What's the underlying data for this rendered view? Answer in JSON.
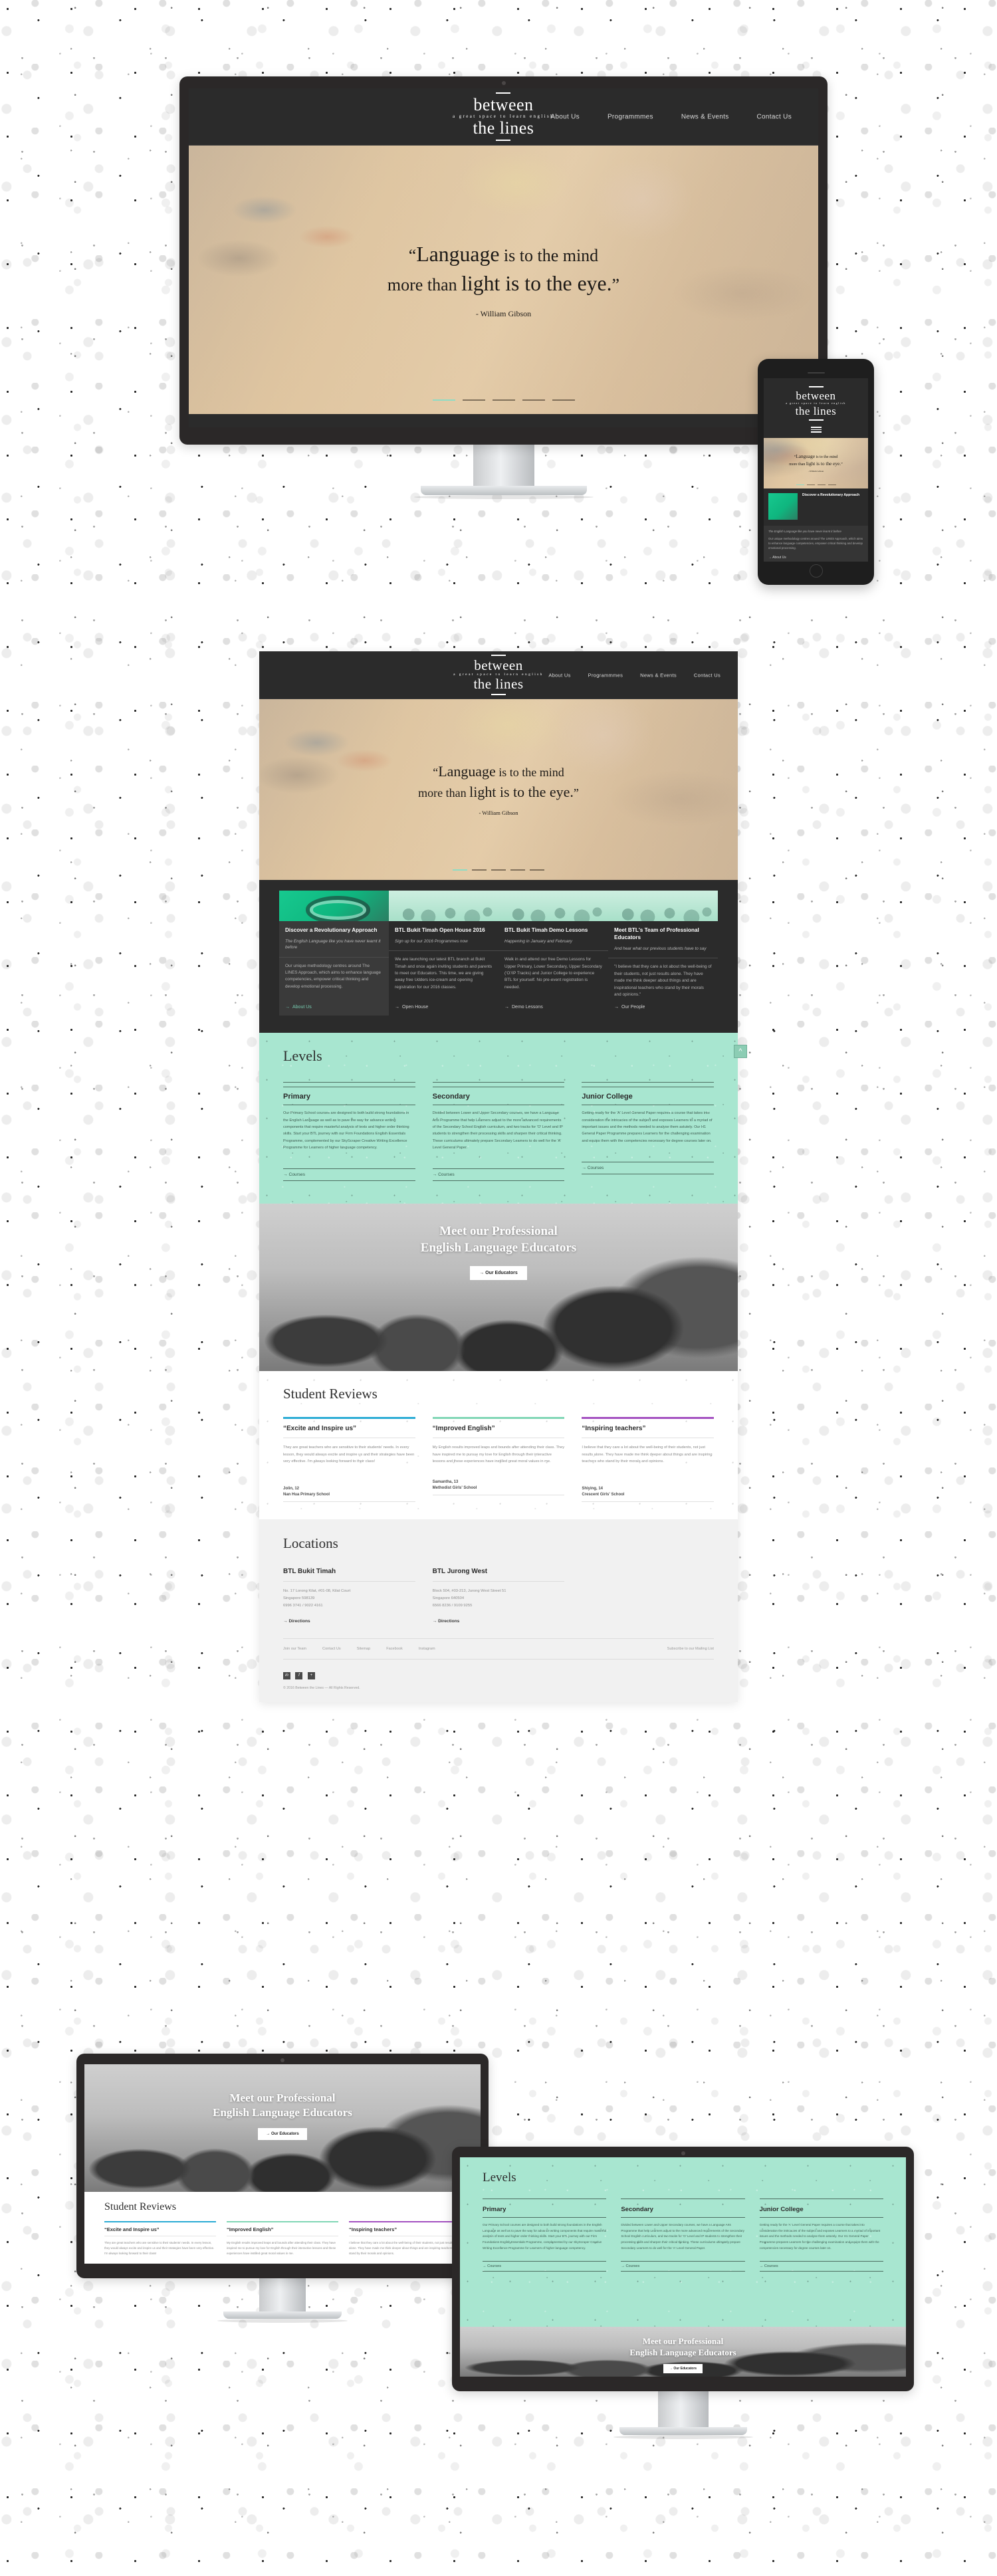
{
  "brand": {
    "line1": "between",
    "tagline": "a great space to learn english",
    "line2": "the lines"
  },
  "nav": [
    {
      "label": "About Us"
    },
    {
      "label": "Programmmes"
    },
    {
      "label": "News & Events"
    },
    {
      "label": "Contact Us"
    }
  ],
  "hero": {
    "quote_line1_emph": "Language",
    "quote_line1_rest": "is to the mind",
    "quote_line2_rest": "more than",
    "quote_line2_emph": "light is to the eye.",
    "attribution": "- William Gibson",
    "open_quote": "“",
    "close_quote": "”",
    "slider_count": 5,
    "slider_active": 1
  },
  "cards": [
    {
      "title": "Discover a Revolutionary Approach",
      "subtitle": "The English Language like you have never learnt it before",
      "body": "Our unique methodology centres around The LINES Approach, which aims to enhance language competencies, empower critical thinking and develop emotional processing.",
      "link": "About Us",
      "thumb": "lines-diagram-image",
      "active": true
    },
    {
      "title": "BTL Bukit Timah Open House 2016",
      "subtitle": "Sign up for our 2016 Programmes now",
      "body": "We are launching our latest BTL branch at Bukit Timah and once again inviting students and parents to meet our Educators. This time, we are giving away free Udders ice-cream and opening registration for our 2016 classes.",
      "link": "Open House",
      "thumb": "audience-photo",
      "active": false
    },
    {
      "title": "BTL Bukit Timah Demo Lessons",
      "subtitle": "Happening in January and February",
      "body": "Walk in and attend our free Demo Lessons for Upper Primary, Lower Secondary, Upper Secondary ('O'/IP Tracks) and Junior College to experience BTL for yourself. No pre-event registration is needed.",
      "link": "Demo Lessons",
      "thumb": "classroom-photo",
      "active": false
    },
    {
      "title": "Meet BTL's Team of Professional Educators",
      "subtitle": "And hear what our previous students have to say",
      "body": "\"I believe that they care a lot about the well-being of their students, not just results alone. They have made me think deeper about things and are inspirational teachers who stand by their morals and opinions.\"",
      "link": "Our People",
      "thumb": "educators-photo",
      "active": false
    }
  ],
  "levels": {
    "heading": "Levels",
    "items": [
      {
        "title": "Primary",
        "body": "Our Primary School courses are designed to both build strong foundations in the English Language as well as to pave the way for advance writing components that require masterful analysis of texts and higher order thinking skills. Start your BTL journey with our Firm Foundations English Essentials Programme, complemented by our SkyScraper Creative Writing Excellence Programme for Learners of higher language competency.",
        "link": "Courses"
      },
      {
        "title": "Secondary",
        "body": "Divided between Lower and Upper Secondary courses, we have a Language Arts Programme that help Learners adjust to the more advanced requirements of the Secondary School English curriculum, and two tracks for 'O' Level and IP students to strengthen their processing skills and sharpen their critical thinking. These curriculums ultimately prepare Secondary Learners to do well for the 'A' Level General Paper.",
        "link": "Courses"
      },
      {
        "title": "Junior College",
        "body": "Getting ready for the 'A' Level General Paper requires a course that takes into consideration the intricacies of the subject and exposes Learners to a myriad of important issues and the methods needed to analyse them astutely. Our H1 General Paper Programme prepares Learners for the challenging examination and equips them with the competencies necessary for degree courses later on.",
        "link": "Courses"
      }
    ],
    "scroll_top_icon": "chevron-up-icon"
  },
  "educators": {
    "heading_line1": "Meet our Professional",
    "heading_line2": "English Language Educators",
    "button": "Our Educators"
  },
  "reviews": {
    "heading": "Student Reviews",
    "items": [
      {
        "bar_color": "#29ABD4",
        "title": "“Excite and Inspire us”",
        "body": "They are great teachers who are sensitive to their students' needs. In every lesson, they would always excite and inspire us and their strategies have been very effective. I'm always looking forward to their class!",
        "name": "Jolin, 12",
        "school": "Nan Hua Primary School"
      },
      {
        "bar_color": "#7FD6B5",
        "title": "“Improved English”",
        "body": "My English results improved leaps and bounds after attending their class. They have inspired me to pursue my love for English through their interactive lessons and these experiences have instilled great moral values in me.",
        "name": "Samantha, 13",
        "school": "Methodist Girls' School"
      },
      {
        "bar_color": "#A34FC0",
        "title": "“Inspiring teachers”",
        "body": "I believe that they care a lot about the well-being of their students, not just results alone. They have made me think deeper about things and are inspiring teachers who stand by their morals and opinions.",
        "name": "Shiying, 14",
        "school": "Crescent Girls' School"
      }
    ]
  },
  "locations": {
    "heading": "Locations",
    "items": [
      {
        "title": "BTL Bukit Timah",
        "address1": "No. 17 Lorong Kilat, #01-08, Kilat Court",
        "address2": "Singapore 598139",
        "phone": "6996 3741 / 9022 4161",
        "link": "Directions"
      },
      {
        "title": "BTL Jurong West",
        "address1": "Block 504, #03-213, Jurong West Street 51",
        "address2": "Singapore 640504",
        "phone": "6566 8236 / 9109 9255",
        "link": "Directions"
      }
    ]
  },
  "footer": {
    "links": [
      "Join our Team",
      "Contact Us",
      "Sitemap",
      "Facebook",
      "Instagram"
    ],
    "subscribe": "Subscribe to our Mailing List",
    "social": [
      {
        "icon": "linkedin-icon",
        "glyph": "in"
      },
      {
        "icon": "facebook-icon",
        "glyph": "f"
      },
      {
        "icon": "plus-icon",
        "glyph": "+"
      }
    ],
    "copyright": "© 2016 Between the Lines — All Rights Reserved."
  },
  "mobile": {
    "menu_icon": "hamburger-menu-icon",
    "card_title": "Discover a Revolutionary Approach",
    "card_sub": "The English Language like you have never learnt it before",
    "card_body": "Our unique methodology centres around The LINES Approach, which aims to enhance language competencies, empower critical thinking and develop emotional processing.",
    "card_link": "About Us"
  },
  "palette": {
    "dark": "#2b2b2b",
    "mint": "#a8e6d0",
    "accent_green": "#17c98f",
    "page_bg": "#ffffff",
    "grey_panel": "#f1f1f1"
  }
}
